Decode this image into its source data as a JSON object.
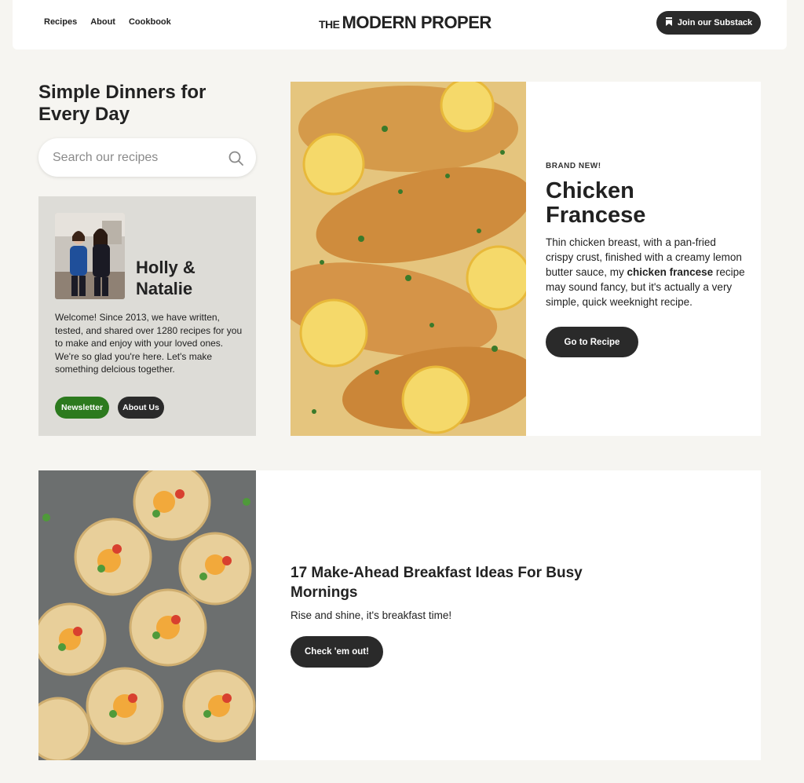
{
  "nav": {
    "items": [
      {
        "label": "Recipes"
      },
      {
        "label": "About"
      },
      {
        "label": "Cookbook"
      }
    ]
  },
  "logo": {
    "prefix": "THE",
    "name": "MODERN PROPER"
  },
  "substack": {
    "label": "Join our Substack",
    "icon": "bookmark-icon"
  },
  "hero": {
    "title": "Simple Dinners for Every Day"
  },
  "search": {
    "placeholder": "Search our recipes",
    "icon": "search-icon"
  },
  "about": {
    "name": "Holly &\nNatalie",
    "text": "Welcome! Since 2013, we have written, tested, and shared over 1280 recipes for you to make and enjoy with your loved ones. We're so glad you're here. Let's make something delcious together.",
    "newsletter_label": "Newsletter",
    "about_label": "About Us"
  },
  "feature": {
    "eyebrow": "BRAND NEW!",
    "title": "Chicken Francese",
    "desc_pre": "Thin chicken breast, with a pan-fried crispy crust, finished with a creamy lemon butter sauce, my ",
    "desc_bold": "chicken francese",
    "desc_post": " recipe may sound fancy, but it's actually a very simple, quick weeknight recipe.",
    "button": "Go to Recipe"
  },
  "card2": {
    "title": "17 Make-Ahead Breakfast Ideas For Busy Mornings",
    "desc": "Rise and shine, it's breakfast time!",
    "button": "Check 'em out!"
  },
  "colors": {
    "dark_button": "#2a2a2a",
    "green_button": "#2c7a1e",
    "page_bg": "#f6f5f1",
    "card_bg": "#dddcd7"
  }
}
